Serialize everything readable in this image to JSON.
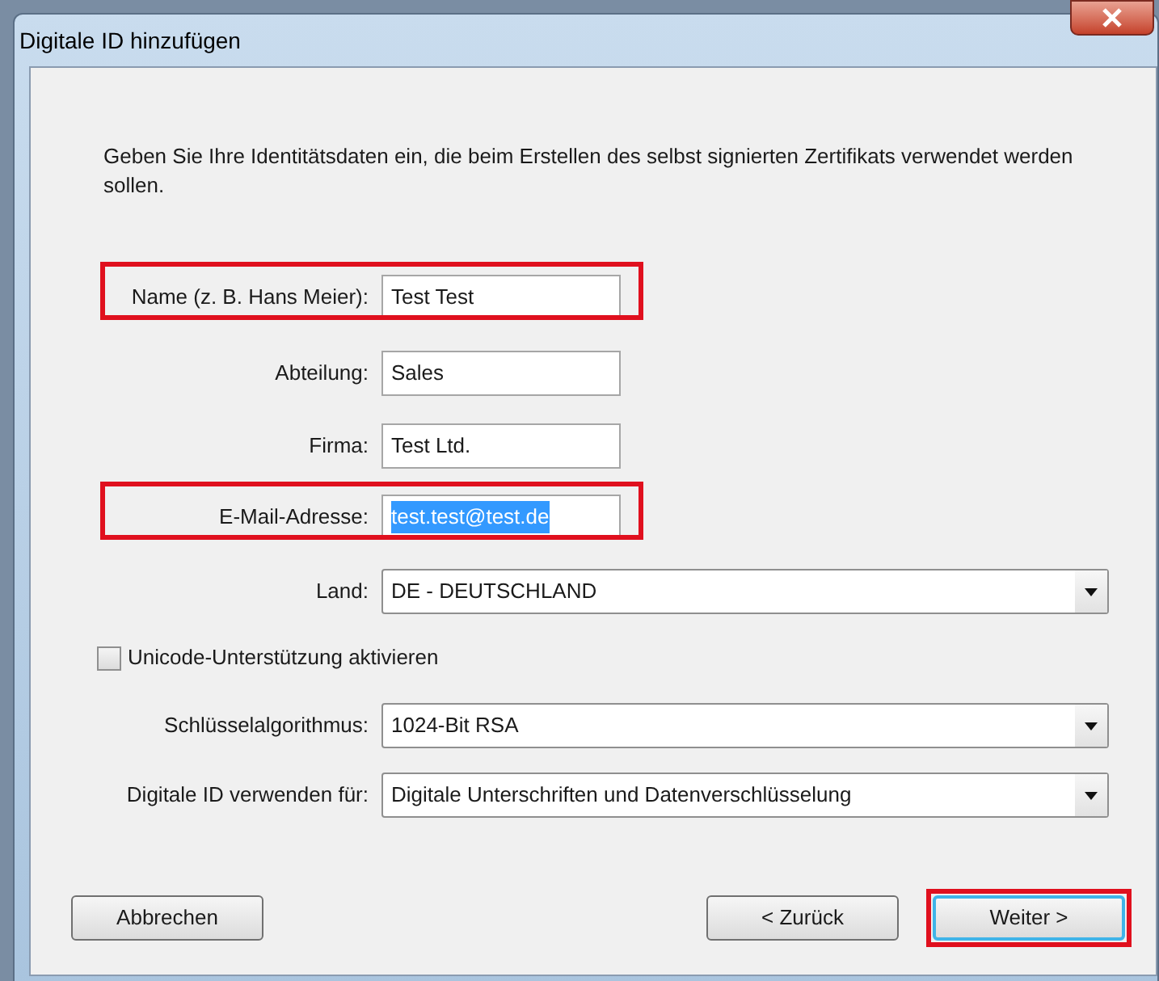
{
  "window": {
    "title": "Digitale ID hinzufügen"
  },
  "intro": "Geben Sie Ihre Identitätsdaten ein, die beim Erstellen des selbst signierten Zertifikats verwendet werden sollen.",
  "rows": [
    {
      "kind": "text",
      "label": "Name (z. B. Hans Meier):",
      "value": "Test Test",
      "highlighted": true,
      "text_selected": false
    },
    {
      "kind": "text",
      "label": "Abteilung:",
      "value": "Sales",
      "highlighted": false,
      "text_selected": false
    },
    {
      "kind": "text",
      "label": "Firma:",
      "value": "Test Ltd.",
      "highlighted": false,
      "text_selected": false
    },
    {
      "kind": "text",
      "label": "E-Mail-Adresse:",
      "value": "test.test@test.de",
      "highlighted": true,
      "text_selected": true
    },
    {
      "kind": "dropdown",
      "label": "Land:",
      "value": "DE - DEUTSCHLAND"
    },
    {
      "kind": "checkbox",
      "label": "Unicode-Unterstützung aktivieren",
      "checked": false
    },
    {
      "kind": "dropdown",
      "label": "Schlüsselalgorithmus:",
      "value": "1024-Bit RSA"
    },
    {
      "kind": "dropdown",
      "label": "Digitale ID verwenden für:",
      "value": "Digitale Unterschriften und Datenverschlüsselung"
    }
  ],
  "buttons": [
    {
      "label": "Abbrechen",
      "highlighted": false
    },
    {
      "label": "< Zurück",
      "highlighted": false
    },
    {
      "label": "Weiter >",
      "highlighted": true
    }
  ]
}
